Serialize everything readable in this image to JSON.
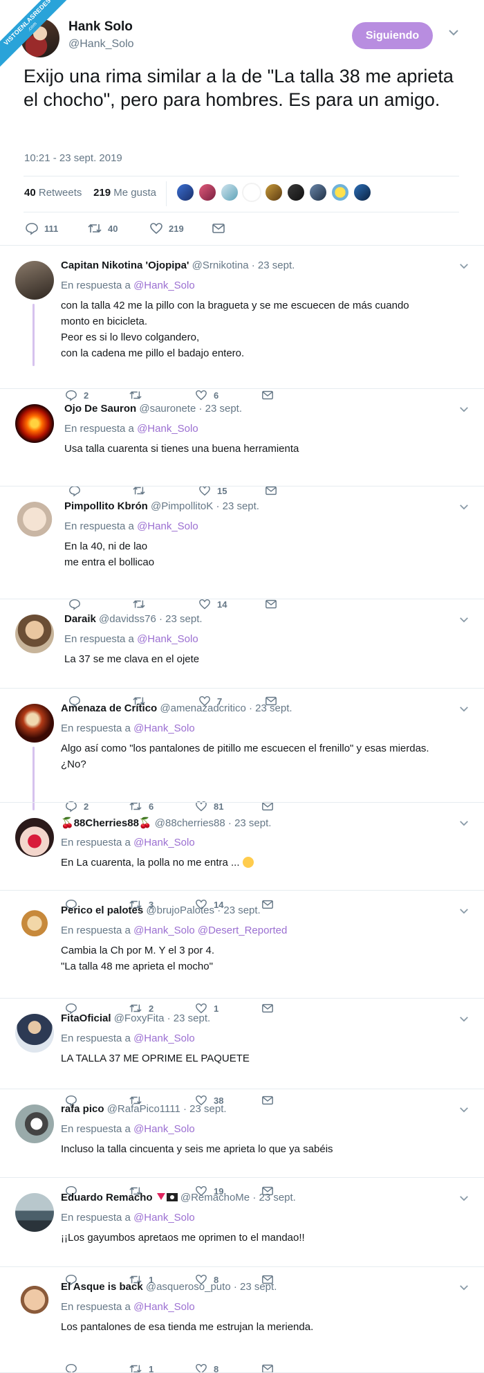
{
  "watermark": {
    "line1": "VISTOENLASREDES",
    "line2": ".com"
  },
  "main_tweet": {
    "name": "Hank Solo",
    "handle": "@Hank_Solo",
    "follow_label": "Siguiendo",
    "text": "Exijo una rima similar a la de \"La talla 38 me aprieta el chocho\", pero para hombres. Es para un amigo.",
    "timestamp": "10:21 - 23 sept. 2019",
    "retweets_count": "40",
    "retweets_label": "Retweets",
    "likes_count": "219",
    "likes_label": "Me gusta",
    "replies": "111",
    "rts": "40",
    "likes": "219"
  },
  "colors": {
    "accent": "#9b6fd1",
    "follow_bg": "#b88de0",
    "muted": "#657786",
    "thread": "#d6c2ee"
  },
  "replies": [
    {
      "name": "Capitan Nikotina 'Ojopipa'",
      "handle": "@Srnikotina",
      "date": "· 23 sept.",
      "in_reply_label": "En respuesta a",
      "in_reply": "@Hank_Solo",
      "lines": [
        "con la talla 42 me la pillo con la bragueta y se me escuecen de más cuando",
        "monto en bicicleta.",
        "Peor es si lo llevo colgandero,",
        "con la cadena me pillo el badajo entero."
      ],
      "replies": "2",
      "rts": "",
      "likes": "6"
    },
    {
      "name": "Ojo De Sauron",
      "handle": "@sauronete",
      "date": "· 23 sept.",
      "in_reply_label": "En respuesta a",
      "in_reply": "@Hank_Solo",
      "lines": [
        "Usa talla cuarenta si tienes una buena herramienta"
      ],
      "replies": "",
      "rts": "",
      "likes": "15"
    },
    {
      "name": "Pimpollito Kbrón",
      "handle": "@PimpollitoK",
      "date": "· 23 sept.",
      "in_reply_label": "En respuesta a",
      "in_reply": "@Hank_Solo",
      "lines": [
        "En la 40, ni de lao",
        "me entra el bollicao"
      ],
      "replies": "",
      "rts": "",
      "likes": "14"
    },
    {
      "name": "Daraik",
      "handle": "@davidss76",
      "date": "· 23 sept.",
      "in_reply_label": "En respuesta a",
      "in_reply": "@Hank_Solo",
      "lines": [
        "La 37 se me clava en el ojete"
      ],
      "replies": "",
      "rts": "",
      "likes": "7"
    },
    {
      "name": "Amenaza de Crítico",
      "handle": "@amenazadcritico",
      "date": "· 23 sept.",
      "in_reply_label": "En respuesta a",
      "in_reply": "@Hank_Solo",
      "lines": [
        "Algo así como \"los pantalones de pitillo me escuecen el frenillo\" y esas mierdas.",
        "¿No?"
      ],
      "replies": "2",
      "rts": "6",
      "likes": "81"
    },
    {
      "name": "88Cherries88",
      "handle": "@88cherries88",
      "date": "· 23 sept.",
      "in_reply_label": "En respuesta a",
      "in_reply": "@Hank_Solo",
      "lines": [
        "En La cuarenta, la polla no me entra ..."
      ],
      "replies": "",
      "rts": "3",
      "likes": "14"
    },
    {
      "name": "Perico el palotes",
      "handle": "@brujoPalotes",
      "date": "· 23 sept.",
      "in_reply_label": "En respuesta a",
      "in_reply": "@Hank_Solo @Desert_Reported",
      "lines": [
        "Cambia la Ch por M. Y el 3 por 4.",
        "\"La talla 48 me aprieta el mocho\""
      ],
      "replies": "",
      "rts": "2",
      "likes": "1"
    },
    {
      "name": "FitaOficial",
      "handle": "@FoxyFita",
      "date": "· 23 sept.",
      "in_reply_label": "En respuesta a",
      "in_reply": "@Hank_Solo",
      "lines": [
        "LA TALLA 37 ME OPRIME EL PAQUETE"
      ],
      "replies": "",
      "rts": "",
      "likes": "38"
    },
    {
      "name": "rafa pico",
      "handle": "@RafaPico1111",
      "date": "· 23 sept.",
      "in_reply_label": "En respuesta a",
      "in_reply": "@Hank_Solo",
      "lines": [
        "Incluso la talla cincuenta y seis me aprieta lo que ya sabéis"
      ],
      "replies": "",
      "rts": "",
      "likes": "19"
    },
    {
      "name": "Eduardo Remacho",
      "handle": "@RemachoMe",
      "date": "· 23 sept.",
      "in_reply_label": "En respuesta a",
      "in_reply": "@Hank_Solo",
      "lines": [
        "¡¡Los gayumbos apretaos me oprimen to el mandao!!"
      ],
      "replies": "",
      "rts": "1",
      "likes": "8"
    },
    {
      "name": "El Asque is back",
      "handle": "@asqueroso_puto",
      "date": "· 23 sept.",
      "in_reply_label": "En respuesta a",
      "in_reply": "@Hank_Solo",
      "lines": [
        "Los pantalones de esa tienda me estrujan la merienda."
      ],
      "replies": "",
      "rts": "1",
      "likes": "8"
    }
  ]
}
